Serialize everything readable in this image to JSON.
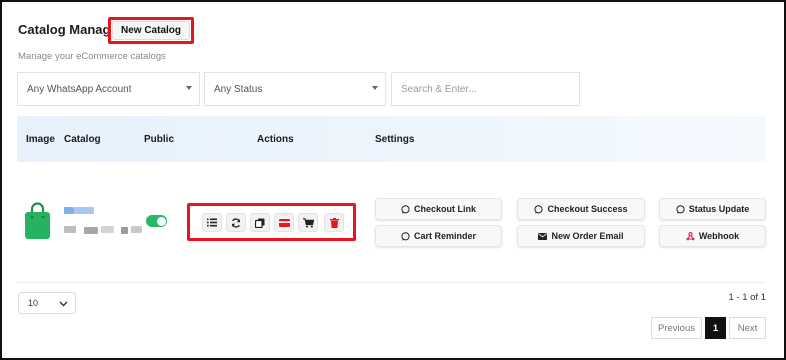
{
  "header": {
    "title": "Catalog Manager",
    "new_button_label": "New Catalog",
    "subtitle": "Manage your eCommerce catalogs"
  },
  "filters": {
    "account_select": "Any WhatsApp Account",
    "status_select": "Any Status",
    "search_placeholder": "Search & Enter..."
  },
  "table": {
    "columns": [
      "Image",
      "Catalog",
      "Public",
      "Actions",
      "Settings"
    ],
    "row": {
      "image_icon": "shopping-bag-icon",
      "public_toggle": true,
      "action_icons": [
        "list-icon",
        "refresh-icon",
        "copy-icon",
        "card-icon",
        "cart-icon",
        "trash-icon"
      ],
      "settings_buttons": [
        {
          "label": "Checkout Link",
          "icon": "whatsapp-icon"
        },
        {
          "label": "Checkout Success",
          "icon": "whatsapp-icon"
        },
        {
          "label": "Status Update",
          "icon": "whatsapp-icon"
        },
        {
          "label": "Cart Reminder",
          "icon": "whatsapp-icon"
        },
        {
          "label": "New Order Email",
          "icon": "envelope-icon"
        },
        {
          "label": "Webhook",
          "icon": "webhook-icon"
        }
      ]
    }
  },
  "footer": {
    "page_size": "10",
    "range_text": "1 - 1 of 1",
    "prev_label": "Previous",
    "current_page": "1",
    "next_label": "Next"
  },
  "colors": {
    "highlight_red": "#e5161c",
    "toggle_green": "#28b765",
    "bag_green": "#27b25f",
    "trash_red": "#e5161c",
    "header_bg": "#e6f1fb",
    "webhook_red": "#e2245a"
  }
}
